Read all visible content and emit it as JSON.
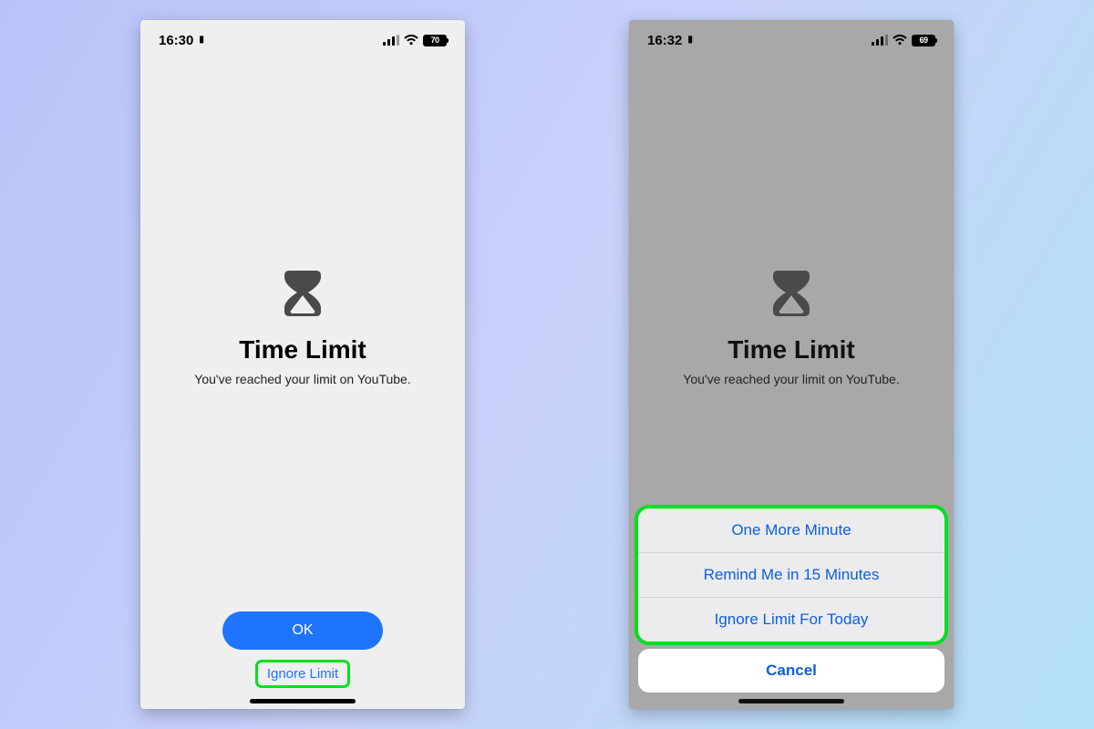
{
  "left": {
    "time": "16:30",
    "battery_pct": "70",
    "title": "Time Limit",
    "subtitle": "You've reached your limit on YouTube.",
    "ok_label": "OK",
    "ignore_label": "Ignore Limit"
  },
  "right": {
    "time": "16:32",
    "battery_pct": "69",
    "title": "Time Limit",
    "subtitle": "You've reached your limit on YouTube.",
    "sheet": {
      "items": [
        "One More Minute",
        "Remind Me in 15 Minutes",
        "Ignore Limit For Today"
      ],
      "cancel": "Cancel"
    }
  },
  "colors": {
    "accent_blue": "#1f74ff",
    "highlight_green": "#00e01d"
  }
}
